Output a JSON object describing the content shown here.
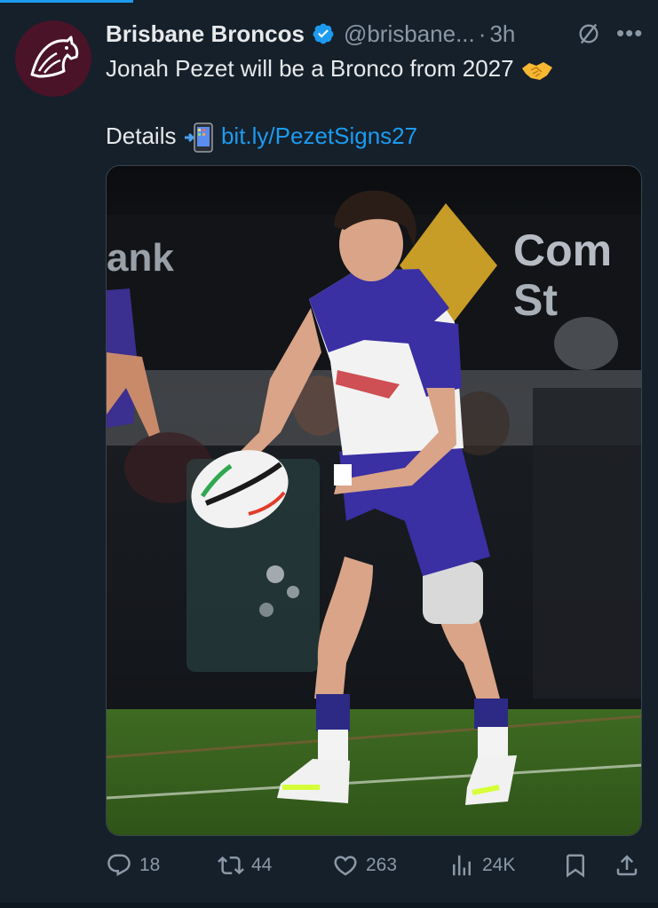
{
  "tweet": {
    "author_name": "Brisbane Broncos",
    "handle": "@brisbane...",
    "separator": "·",
    "time": "3h",
    "line1": "Jonah Pezet will be a Bronco from 2027",
    "line1_emoji": "handshake-emoji",
    "details_label": "Details",
    "details_emoji": "mobile-phone-arrow-emoji",
    "link": "bit.ly/PezetSigns27",
    "image_signage_left": "ank",
    "image_signage_right_1": "Com",
    "image_signage_right_2": "St"
  },
  "actions": {
    "replies": "18",
    "reposts": "44",
    "likes": "263",
    "views": "24K"
  },
  "colors": {
    "background": "#15202b",
    "link": "#1d9bf0",
    "muted": "#8b98a5",
    "avatar": "#4a1328"
  }
}
